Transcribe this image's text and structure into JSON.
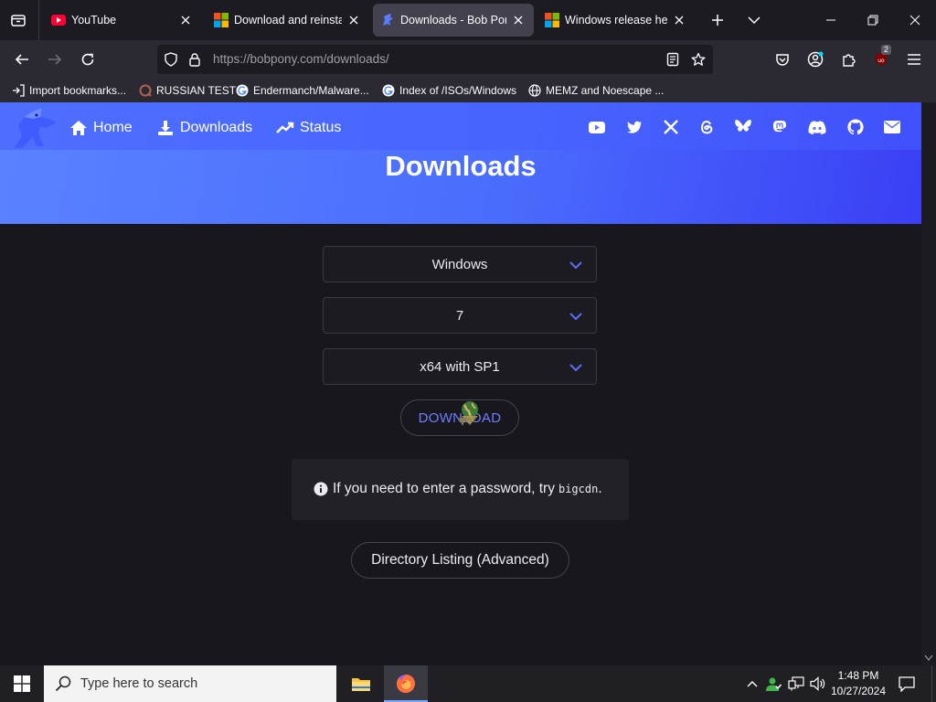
{
  "browser": {
    "tabs": [
      {
        "title": "YouTube",
        "favicon": "youtube-icon"
      },
      {
        "title": "Download and reinstall",
        "favicon": "microsoft-icon"
      },
      {
        "title": "Downloads - Bob Pony",
        "favicon": "bobpony-icon",
        "active": true
      },
      {
        "title": "Windows release health",
        "favicon": "microsoft-icon"
      }
    ],
    "url_host": "https://bobpony.com",
    "url_path": "/downloads/",
    "extension_badge": "2",
    "bookmarks": [
      {
        "label": "Import bookmarks...",
        "icon": "import-icon"
      },
      {
        "label": "RUSSIAN TEST",
        "icon": "russian-test-icon"
      },
      {
        "label": "Endermanch/Malware...",
        "icon": "google-icon"
      },
      {
        "label": "Index of /ISOs/Windows",
        "icon": "google-icon"
      },
      {
        "label": "MEMZ and Noescape ...",
        "icon": "globe-icon"
      }
    ]
  },
  "site": {
    "nav": [
      {
        "label": "Home",
        "icon": "home-icon"
      },
      {
        "label": "Downloads",
        "icon": "download-icon"
      },
      {
        "label": "Status",
        "icon": "trend-icon"
      }
    ],
    "socials": [
      "youtube-icon",
      "twitter-icon",
      "x-icon",
      "threads-icon",
      "bluesky-icon",
      "mastodon-icon",
      "discord-icon",
      "github-icon",
      "mail-icon"
    ],
    "title": "Downloads",
    "selects": {
      "os": "Windows",
      "version": "7",
      "edition": "x64 with SP1"
    },
    "download_label": "DOWNLOAD",
    "notice_text": "If you need to enter a password, try",
    "notice_code": "bigcdn",
    "notice_end": ".",
    "directory_label": "Directory Listing (Advanced)"
  },
  "taskbar": {
    "search_placeholder": "Type here to search",
    "time": "1:48 PM",
    "date": "10/27/2024"
  },
  "colors": {
    "accent": "#4a6cfd",
    "download_text": "#6f7dff",
    "background": "#18171d"
  }
}
